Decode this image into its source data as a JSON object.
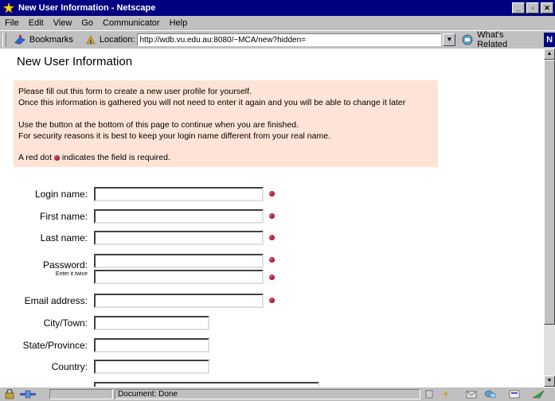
{
  "window": {
    "title": "New User Information - Netscape"
  },
  "menu": {
    "items": [
      "File",
      "Edit",
      "View",
      "Go",
      "Communicator",
      "Help"
    ]
  },
  "location_bar": {
    "bookmarks_label": "Bookmarks",
    "location_label": "Location:",
    "url": "http://wdb.vu.edu.au:8080/~MCA/new?hidden=",
    "related_label": "What's Related"
  },
  "page": {
    "title": "New User Information",
    "info_lines": [
      "Please fill out this form to create a new user profile for yourself.",
      "Once this information is gathered you will not need to enter it again and you will be able to change it later",
      "Use the button at the bottom of this page to continue when you are finished.",
      "For security reasons it is best to keep your login name different from your real name."
    ],
    "red_dot_prefix": "A red dot",
    "red_dot_suffix": "indicates the field is required."
  },
  "form": {
    "login_label": "Login name:",
    "first_label": "First name:",
    "last_label": "Last name:",
    "password_label": "Password:",
    "password_hint": "Enter it twice",
    "email_label": "Email address:",
    "city_label": "City/Town:",
    "state_label": "State/Province:",
    "country_label": "Country:",
    "login_value": "",
    "first_value": "",
    "last_value": "",
    "password_value": "",
    "password2_value": "",
    "email_value": "",
    "city_value": "",
    "state_value": "",
    "country_value": ""
  },
  "status": {
    "text": "Document: Done"
  },
  "colors": {
    "titlebar": "#000080",
    "info_background": "#fde4d6",
    "required_dot": "#a0102a"
  }
}
